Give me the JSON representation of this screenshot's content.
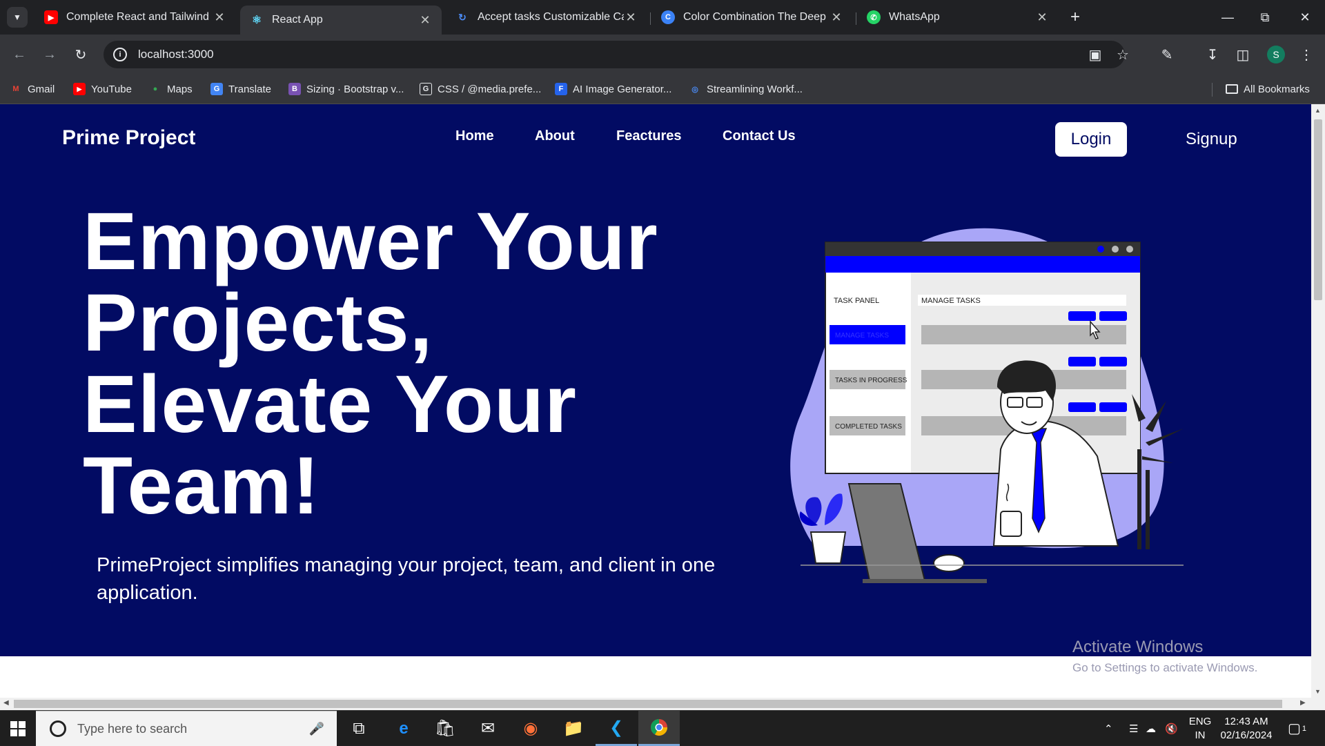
{
  "browser": {
    "tabs": [
      {
        "title": "Complete React and Tailwind CS",
        "favicon": "youtube-icon",
        "color": "#ff0000"
      },
      {
        "title": "React App",
        "favicon": "react-icon",
        "color": "#61dafb"
      },
      {
        "title": "Accept tasks Customizable Cart",
        "favicon": "loading-icon",
        "color": "#4b8bf5"
      },
      {
        "title": "Color Combination The Deep Bl",
        "favicon": "canva-icon",
        "color": "#3b82f6"
      },
      {
        "title": "WhatsApp",
        "favicon": "whatsapp-icon",
        "color": "#25d366"
      }
    ],
    "address": "localhost:3000",
    "profile_initial": "S",
    "bookmarks": [
      {
        "label": "Gmail",
        "icon": "gmail-icon"
      },
      {
        "label": "YouTube",
        "icon": "youtube-icon"
      },
      {
        "label": "Maps",
        "icon": "maps-icon"
      },
      {
        "label": "Translate",
        "icon": "translate-icon"
      },
      {
        "label": "Sizing · Bootstrap v...",
        "icon": "bootstrap-icon"
      },
      {
        "label": "CSS / @media.prefe...",
        "icon": "css-icon"
      },
      {
        "label": "AI Image Generator...",
        "icon": "ai-image-icon"
      },
      {
        "label": "Streamlining Workf...",
        "icon": "streamlining-icon"
      }
    ],
    "all_bookmarks": "All Bookmarks"
  },
  "site": {
    "brand": "Prime Project",
    "nav": [
      "Home",
      "About",
      "Feactures",
      "Contact Us"
    ],
    "login": "Login",
    "signup": "Signup",
    "headline": [
      "Empower Your",
      "Projects,",
      "Elevate Your",
      "Team!"
    ],
    "subtext": "PrimeProject simplifies managing your project, team, and client in one application.",
    "illustration": {
      "panel_title": "TASK PANEL",
      "manage_title": "MANAGE TASKS",
      "menu": [
        "MANAGE TASKS",
        "TASKS IN PROGRESS",
        "COMPLETED TASKS"
      ]
    },
    "colors": {
      "hero_bg": "#020b63",
      "accent": "#0000ff",
      "blob": "#a9a6f7"
    }
  },
  "watermark": {
    "line1": "Activate Windows",
    "line2": "Go to Settings to activate Windows."
  },
  "taskbar": {
    "search_placeholder": "Type here to search",
    "lang": "ENG",
    "region": "IN",
    "time": "12:43 AM",
    "date": "02/16/2024",
    "notifications": "1"
  }
}
